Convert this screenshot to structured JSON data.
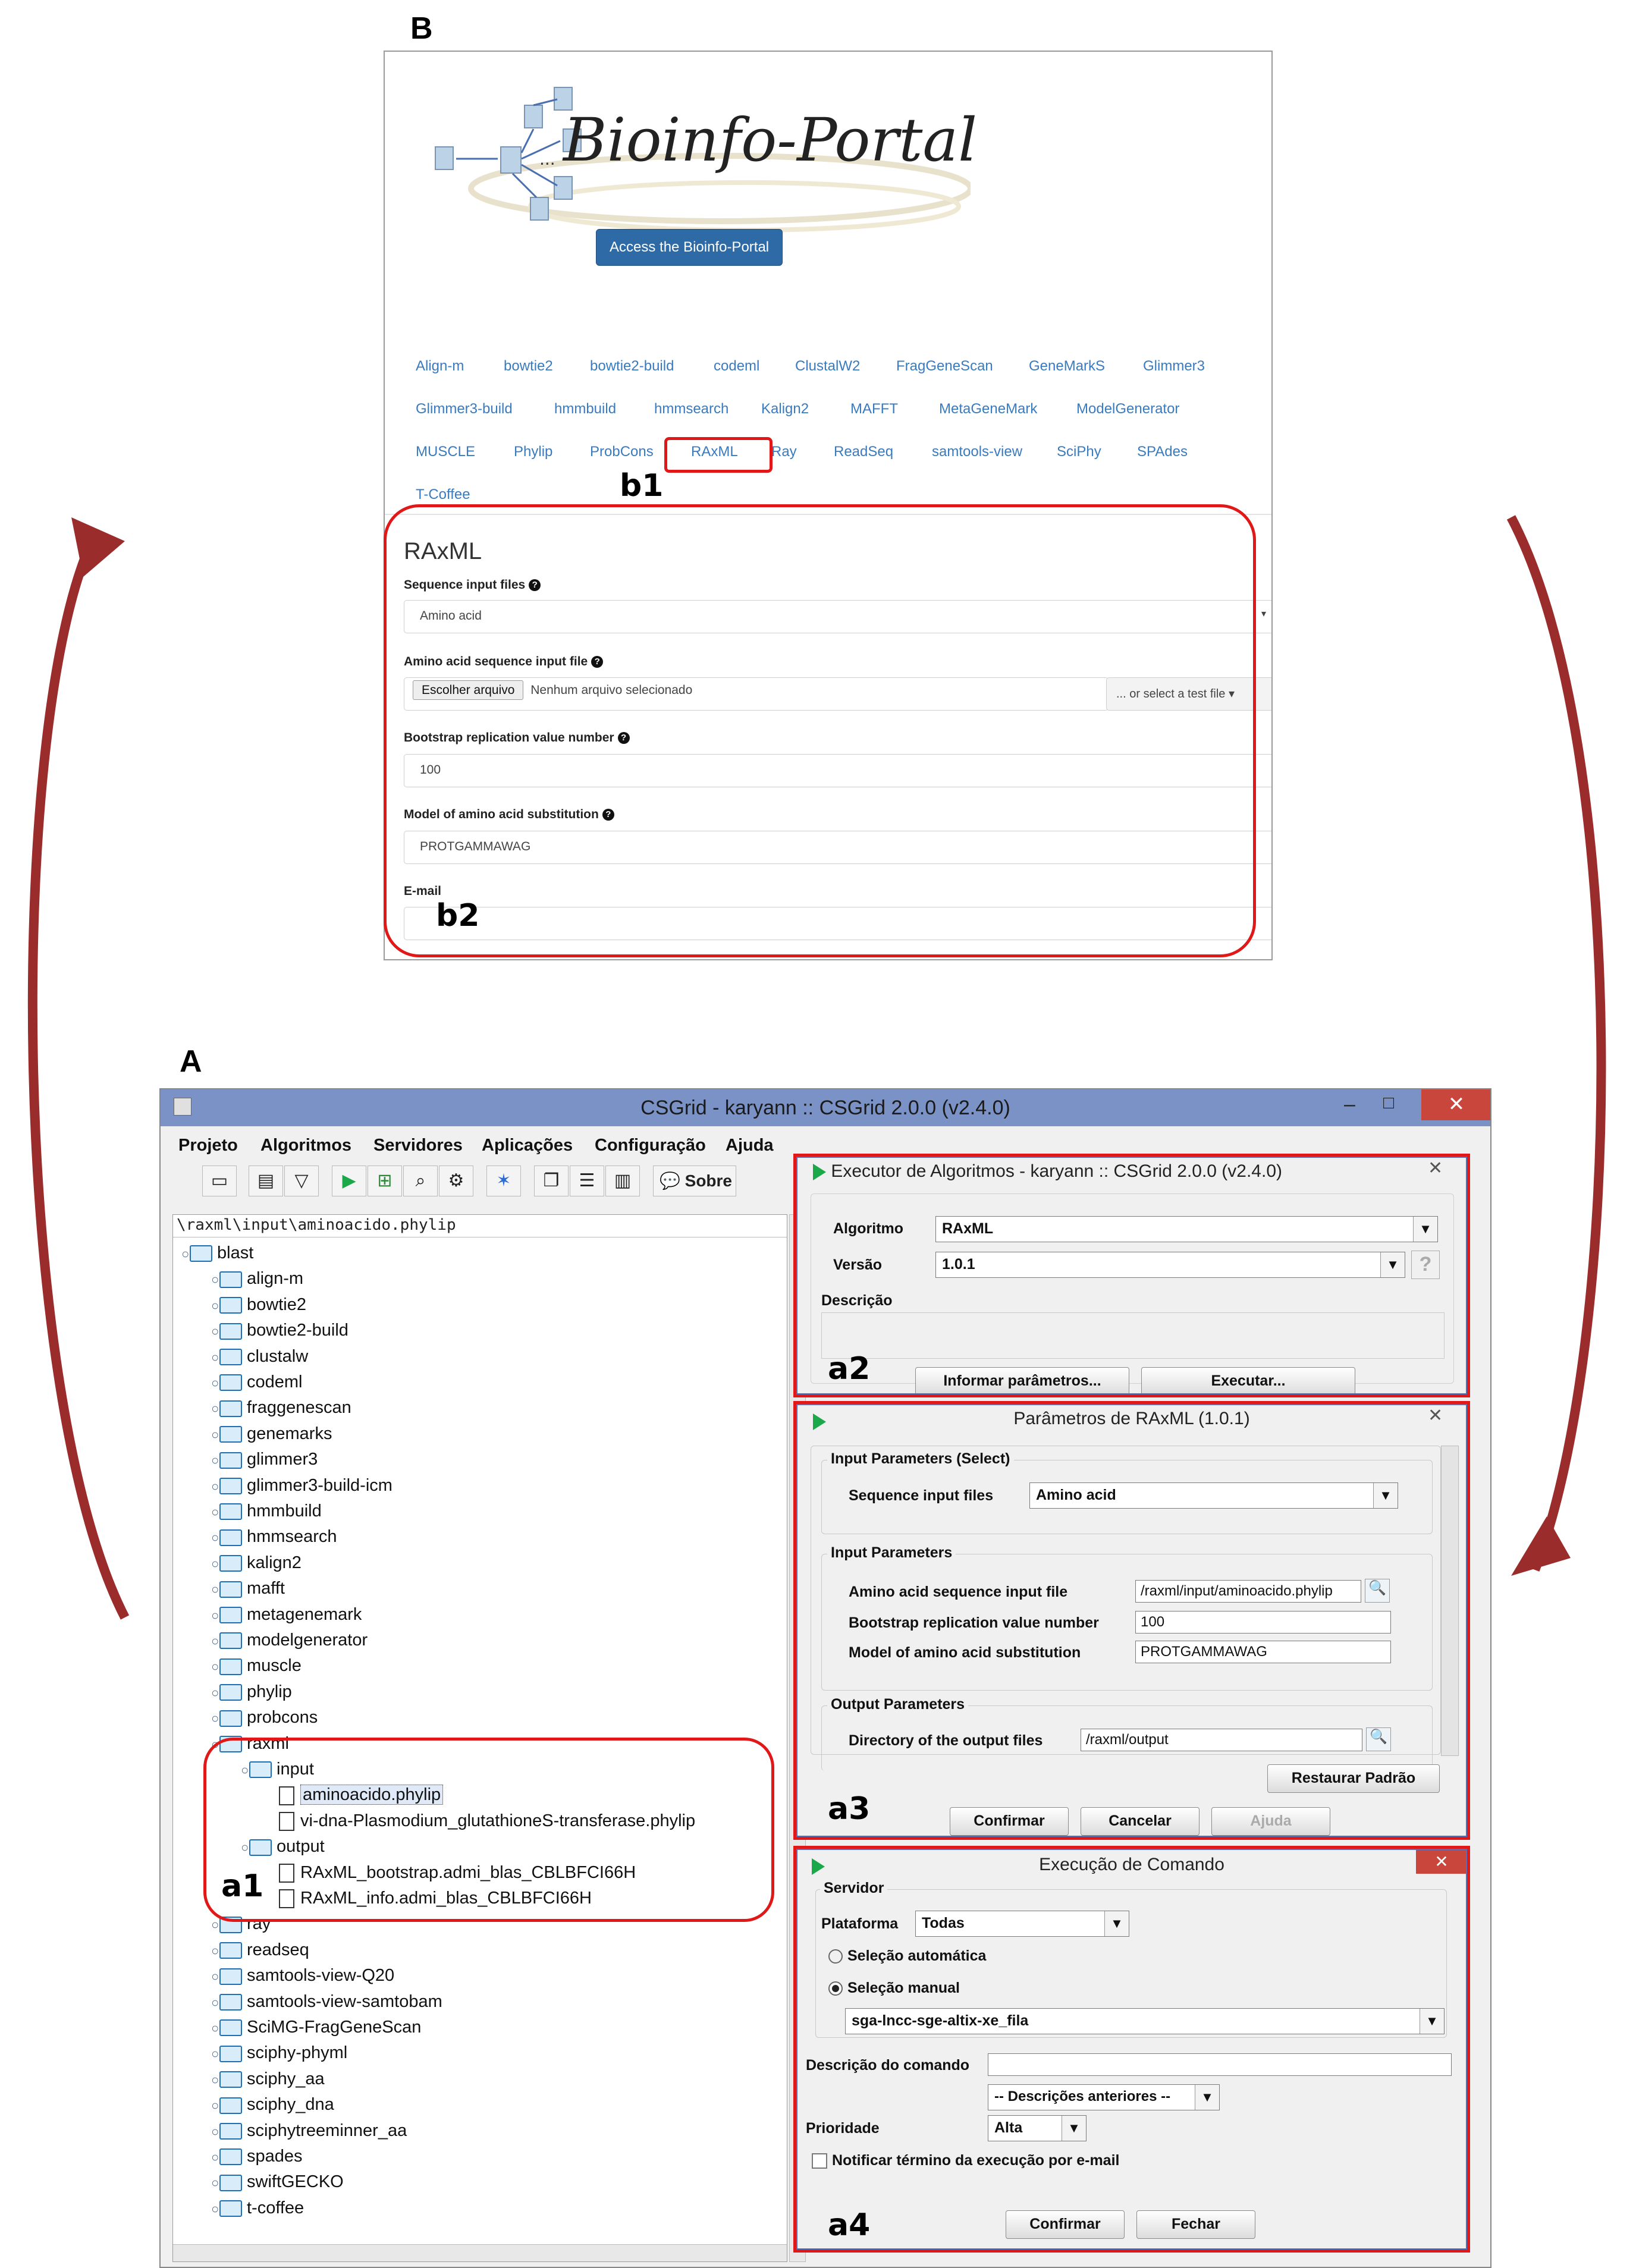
{
  "panel_b": {
    "letter": "B",
    "logo_text": "Bioinfo-Portal",
    "access_button": "Access the Bioinfo-Portal",
    "tools": [
      "Align-m",
      "bowtie2",
      "bowtie2-build",
      "codeml",
      "ClustalW2",
      "FragGeneScan",
      "GeneMarkS",
      "Glimmer3",
      "Glimmer3-build",
      "hmmbuild",
      "hmmsearch",
      "Kalign2",
      "MAFFT",
      "MetaGeneMark",
      "ModelGenerator",
      "MUSCLE",
      "Phylip",
      "ProbCons",
      "RAxML",
      "Ray",
      "ReadSeq",
      "samtools-view",
      "SciPhy",
      "SPAdes",
      "T-Coffee"
    ],
    "selected_tool": "RAxML",
    "callout_b1": "b1",
    "callout_b2": "b2",
    "form": {
      "heading": "RAxML",
      "seq_label": "Sequence input files",
      "seq_value": "Amino acid",
      "aa_label": "Amino acid sequence input file",
      "file_button": "Escolher arquivo",
      "file_status": "Nenhum arquivo selecionado",
      "test_file": "... or select a test file",
      "bootstrap_label": "Bootstrap replication value number",
      "bootstrap_value": "100",
      "model_label": "Model of amino acid substitution",
      "model_value": "PROTGAMMAWAG",
      "email_label": "E-mail"
    }
  },
  "panel_a": {
    "letter": "A",
    "window_title": "CSGrid - karyann :: CSGrid 2.0.0 (v2.4.0)",
    "menu": [
      "Projeto",
      "Algoritmos",
      "Servidores",
      "Aplicações",
      "Configuração",
      "Ajuda"
    ],
    "sobre_label": "Sobre",
    "path": "\\raxml\\input\\aminoacido.phylip",
    "tree_root": "blast",
    "folders_before": [
      "align-m",
      "bowtie2",
      "bowtie2-build",
      "clustalw",
      "codeml",
      "fraggenescan",
      "genemarks",
      "glimmer3",
      "glimmer3-build-icm",
      "hmmbuild",
      "hmmsearch",
      "kalign2",
      "mafft",
      "metagenemark",
      "modelgenerator",
      "muscle",
      "phylip",
      "probcons",
      "raxml"
    ],
    "raxml_children": {
      "input": "input",
      "input_files": [
        "aminoacido.phylip",
        "vi-dna-Plasmodium_glutathioneS-transferase.phylip"
      ],
      "output": "output",
      "output_files": [
        "RAxML_bootstrap.admi_blas_CBLBFCI66H",
        "RAxML_info.admi_blas_CBLBFCI66H"
      ]
    },
    "folders_after": [
      "ray",
      "readseq",
      "samtools-view-Q20",
      "samtools-view-samtobam",
      "SciMG-FragGeneScan",
      "sciphy-phyml",
      "sciphy_aa",
      "sciphy_dna",
      "sciphytreeminner_aa",
      "spades",
      "swiftGECKO",
      "t-coffee"
    ],
    "callouts": {
      "a1": "a1",
      "a2": "a2",
      "a3": "a3",
      "a4": "a4"
    },
    "executor": {
      "title": "Executor de Algoritmos - karyann :: CSGrid 2.0.0 (v2.4.0)",
      "algoritmo_label": "Algoritmo",
      "algoritmo_value": "RAxML",
      "versao_label": "Versão",
      "versao_value": "1.0.1",
      "descricao_label": "Descrição",
      "btn_params": "Informar parâmetros...",
      "btn_exec": "Executar..."
    },
    "params": {
      "title": "Parâmetros de RAxML (1.0.1)",
      "group1": "Input Parameters (Select)",
      "seq_label": "Sequence input files",
      "seq_value": "Amino acid",
      "group2": "Input Parameters",
      "aa_label": "Amino acid sequence input file",
      "aa_value": "/raxml/input/aminoacido.phylip",
      "boot_label": "Bootstrap replication value number",
      "boot_value": "100",
      "model_label": "Model of amino acid substitution",
      "model_value": "PROTGAMMAWAG",
      "group3": "Output Parameters",
      "out_label": "Directory of the output files",
      "out_value": "/raxml/output",
      "btn_restore": "Restaurar Padrão",
      "btn_confirm": "Confirmar",
      "btn_cancel": "Cancelar",
      "btn_help": "Ajuda"
    },
    "exec_cmd": {
      "title": "Execução de Comando",
      "servidor": "Servidor",
      "plataforma_label": "Plataforma",
      "plataforma_value": "Todas",
      "auto": "Seleção automática",
      "manual": "Seleção manual",
      "server_value": "sga-lncc-sge-altix-xe_fila",
      "desc_label": "Descrição do comando",
      "prev_desc": "-- Descrições anteriores --",
      "prio_label": "Prioridade",
      "prio_value": "Alta",
      "notify": "Notificar término da execução por e-mail",
      "btn_confirm": "Confirmar",
      "btn_close": "Fechar"
    }
  },
  "colors": {
    "highlight": "#e01818",
    "arrow": "#9b2c2c",
    "link": "#3a7bbf",
    "titlebar": "#7b92c6"
  }
}
